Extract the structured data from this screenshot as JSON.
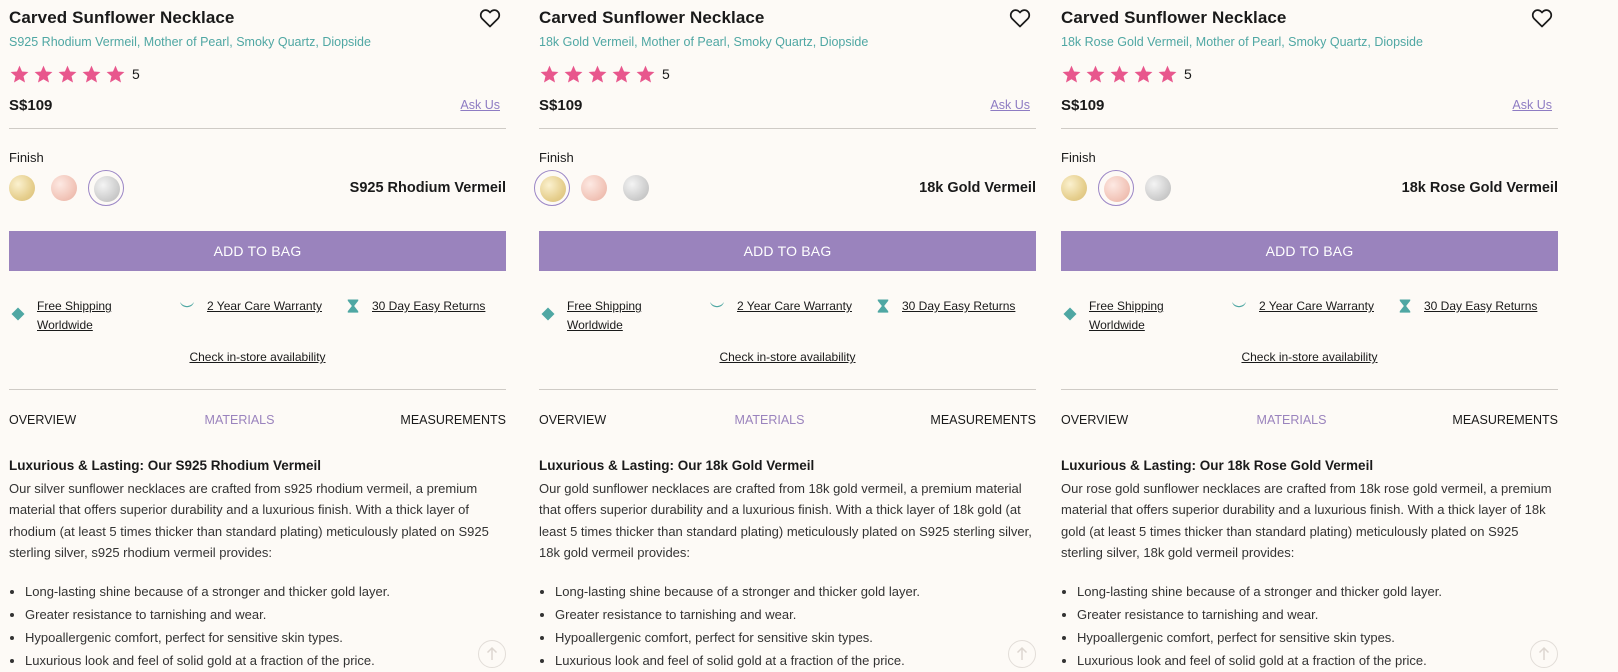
{
  "common": {
    "title": "Carved Sunflower Necklace",
    "rating": "5",
    "price": "S$109",
    "ask_us": "Ask Us",
    "finish_label": "Finish",
    "add_to_bag": "ADD TO BAG",
    "perks": {
      "shipping": "Free Shipping\nWorldwide",
      "warranty": "2 Year Care Warranty",
      "returns": "30 Day Easy Returns"
    },
    "instore": "Check in-store availability",
    "tabs": [
      "OVERVIEW",
      "MATERIALS",
      "MEASUREMENTS"
    ],
    "bullets": [
      "Long-lasting shine because of a stronger and thicker gold layer.",
      "Greater resistance to tarnishing and wear.",
      "Hypoallergenic comfort, perfect for sensitive skin types.",
      "Luxurious look and feel of solid gold at a fraction of the price."
    ]
  },
  "colors": {
    "accent_purple": "#9a83bd",
    "teal": "#4fa7a3",
    "star_pink": "#e8578d",
    "background": "#fdfaf6"
  },
  "icons": [
    "heart-icon",
    "star-icon",
    "diamond-icon",
    "smile-icon",
    "hourglass-icon",
    "arrow-up-icon"
  ],
  "panels": [
    {
      "subtitle": "S925 Rhodium Vermeil, Mother of Pearl, Smoky Quartz, Diopside",
      "selected_finish": "silver",
      "finish_name": "S925 Rhodium Vermeil",
      "content_title": "Luxurious & Lasting: Our S925 Rhodium Vermeil",
      "content_body": "Our silver sunflower necklaces are crafted from s925 rhodium vermeil, a premium material that offers superior durability and a luxurious finish. With a thick layer of rhodium (at least 5 times thicker than standard plating) meticulously plated on S925 sterling silver, s925 rhodium vermeil provides:"
    },
    {
      "subtitle": "18k Gold Vermeil, Mother of Pearl, Smoky Quartz, Diopside",
      "selected_finish": "gold",
      "finish_name": "18k Gold Vermeil",
      "content_title": "Luxurious & Lasting: Our 18k Gold Vermeil",
      "content_body": "Our gold sunflower necklaces are crafted from 18k gold vermeil, a premium material that offers superior durability and a luxurious finish. With a thick layer of 18k gold (at least 5 times thicker than standard plating) meticulously plated on S925 sterling silver, 18k gold vermeil provides:"
    },
    {
      "subtitle": "18k Rose Gold Vermeil, Mother of Pearl, Smoky Quartz, Diopside",
      "selected_finish": "rose",
      "finish_name": "18k Rose Gold Vermeil",
      "content_title": "Luxurious & Lasting: Our 18k Rose Gold Vermeil",
      "content_body": "Our rose gold sunflower necklaces are crafted from 18k rose gold vermeil, a premium material that offers superior durability and a luxurious finish. With a thick layer of 18k gold (at least 5 times thicker than standard plating) meticulously plated on S925 sterling silver, 18k gold vermeil provides:"
    }
  ]
}
